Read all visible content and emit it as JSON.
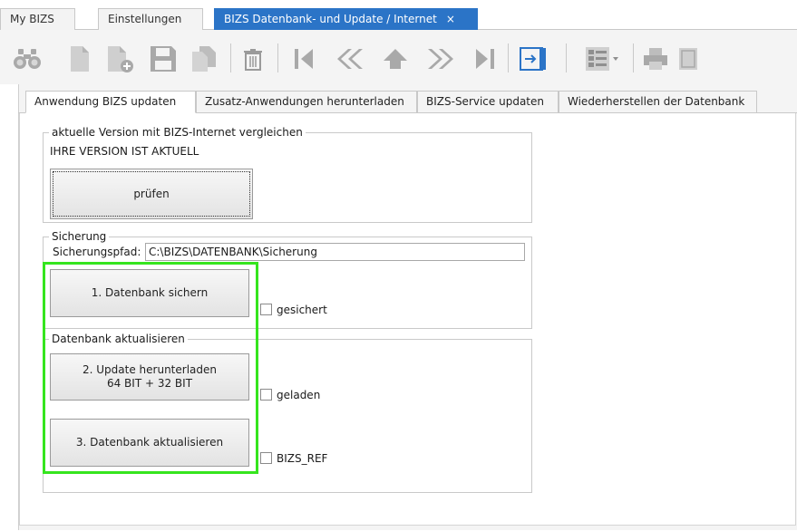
{
  "doc_tabs": [
    {
      "label": "My BIZS",
      "active": false
    },
    {
      "label": "Einstellungen",
      "active": false
    },
    {
      "label": "BIZS Datenbank- und Update / Internet",
      "active": true
    }
  ],
  "doc_tab_close": "×",
  "toolbar": {
    "icons": [
      "binoculars-icon",
      "new-document-icon",
      "add-document-icon",
      "save-icon",
      "copy-icon",
      "delete-icon",
      "first-record-icon",
      "previous-record-icon",
      "up-icon",
      "next-record-icon",
      "last-record-icon",
      "exit-icon",
      "view-layout-icon",
      "print-icon",
      "report-icon"
    ]
  },
  "sub_tabs": [
    {
      "label": "Anwendung BIZS updaten",
      "active": true
    },
    {
      "label": "Zusatz-Anwendungen herunterladen",
      "active": false
    },
    {
      "label": "BIZS-Service updaten",
      "active": false
    },
    {
      "label": "Wiederherstellen der Datenbank",
      "active": false
    }
  ],
  "version_group": {
    "title": "aktuelle Version mit BIZS-Internet vergleichen",
    "status": "IHRE VERSION IST AKTUELL",
    "check_button": "prüfen"
  },
  "backup_group": {
    "title": "Sicherung",
    "path_label": "Sicherungspfad:",
    "path_value": "C:\\BIZS\\DATENBANK\\Sicherung",
    "backup_button": "1. Datenbank sichern",
    "backup_checkbox": "gesichert"
  },
  "update_group": {
    "title": "Datenbank aktualisieren",
    "download_button_line1": "2. Update herunterladen",
    "download_button_line2": "64 BIT + 32 BIT",
    "download_checkbox": "geladen",
    "update_button": "3. Datenbank aktualisieren",
    "update_checkbox": "BIZS_REF"
  },
  "colors": {
    "active_tab": "#2b74c7",
    "highlight": "#35e51e",
    "icon_gray": "#a9a9a9",
    "icon_blue": "#2b74c7"
  }
}
